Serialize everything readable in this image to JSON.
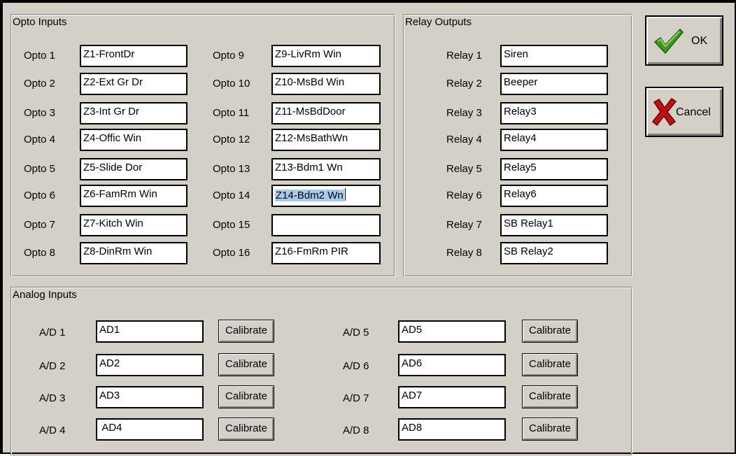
{
  "opto_group": {
    "title": "Opto Inputs",
    "items": [
      {
        "label": "Opto 1",
        "value": "Z1-FrontDr"
      },
      {
        "label": "Opto 2",
        "value": "Z2-Ext Gr Dr"
      },
      {
        "label": "Opto 3",
        "value": "Z3-Int Gr Dr"
      },
      {
        "label": "Opto 4",
        "value": "Z4-Offic Win"
      },
      {
        "label": "Opto 5",
        "value": "Z5-Slide Dor"
      },
      {
        "label": "Opto 6",
        "value": "Z6-FamRm Win"
      },
      {
        "label": "Opto 7",
        "value": "Z7-Kitch Win"
      },
      {
        "label": "Opto 8",
        "value": "Z8-DinRm Win"
      },
      {
        "label": "Opto 9",
        "value": "Z9-LivRm Win"
      },
      {
        "label": "Opto 10",
        "value": "Z10-MsBd Win"
      },
      {
        "label": "Opto 11",
        "value": "Z11-MsBdDoor"
      },
      {
        "label": "Opto 12",
        "value": "Z12-MsBathWn"
      },
      {
        "label": "Opto 13",
        "value": "Z13-Bdm1 Wn"
      },
      {
        "label": "Opto 14",
        "value": "Z14-Bdm2 Wn"
      },
      {
        "label": "Opto 15",
        "value": ""
      },
      {
        "label": "Opto 16",
        "value": "Z16-FmRm PIR"
      }
    ]
  },
  "relay_group": {
    "title": "Relay Outputs",
    "items": [
      {
        "label": "Relay 1",
        "value": "Siren"
      },
      {
        "label": "Relay 2",
        "value": "Beeper"
      },
      {
        "label": "Relay 3",
        "value": "Relay3"
      },
      {
        "label": "Relay 4",
        "value": "Relay4"
      },
      {
        "label": "Relay 5",
        "value": "Relay5"
      },
      {
        "label": "Relay 6",
        "value": "Relay6"
      },
      {
        "label": "Relay 7",
        "value": "SB Relay1"
      },
      {
        "label": "Relay 8",
        "value": "SB Relay2"
      }
    ]
  },
  "analog_group": {
    "title": "Analog Inputs",
    "calibrate_label": "Calibrate",
    "items": [
      {
        "label": "A/D 1",
        "value": "AD1"
      },
      {
        "label": "A/D 2",
        "value": "AD2"
      },
      {
        "label": "A/D 3",
        "value": "AD3"
      },
      {
        "label": "A/D 4",
        "value": " AD4"
      },
      {
        "label": "A/D 5",
        "value": "AD5"
      },
      {
        "label": "A/D 6",
        "value": "AD6"
      },
      {
        "label": "A/D 7",
        "value": "AD7"
      },
      {
        "label": "A/D 8",
        "value": "AD8"
      }
    ]
  },
  "buttons": {
    "ok_label": "OK",
    "cancel_label": "Cancel"
  },
  "focused_field": "Opto 14",
  "colors": {
    "dialog_bg": "#d4d0c8",
    "selection_bg": "#a6caf0",
    "ok_check": "#3a9a1a",
    "cancel_x": "#c01010"
  }
}
